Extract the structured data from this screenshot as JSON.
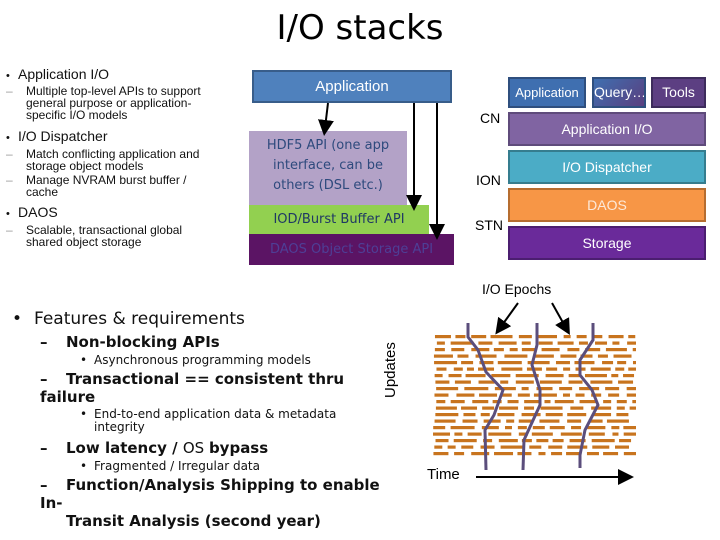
{
  "title": "I/O stacks",
  "top_bullets": [
    {
      "label": "Application I/O",
      "subs": [
        "Multiple top-level APIs to support",
        "general purpose or application-",
        "specific I/O models"
      ]
    },
    {
      "label": "I/O Dispatcher",
      "subs": [
        "Match conflicting application and",
        "storage object models",
        "Manage NVRAM burst buffer /",
        "cache"
      ]
    },
    {
      "label": "DAOS",
      "subs": [
        "Scalable, transactional global",
        "shared object storage"
      ]
    }
  ],
  "middle_stack": {
    "application": "Application",
    "hdf5_lines": [
      "HDF5 API (one app",
      "interface, can be",
      "others (DSL etc.)"
    ],
    "iod": "IOD/Burst Buffer API",
    "daos": "DAOS Object Storage API"
  },
  "right_stack": {
    "row1": [
      "Application",
      "Query…",
      "Tools"
    ],
    "application_io": "Application I/O",
    "dispatcher": "I/O Dispatcher",
    "daos": "DAOS",
    "storage": "Storage",
    "node_labels": [
      "CN",
      "ION",
      "STN"
    ],
    "colors": {
      "application": "#3f6fb0",
      "tools": "#5c3f82",
      "application_io": "#8064a2",
      "dispatcher": "#4bacc6",
      "daos": "#f79646",
      "storage": "#6a2a9a"
    }
  },
  "features": {
    "heading": "Features & requirements",
    "items": [
      {
        "label": "Non-blocking APIs",
        "sub": [
          "Asynchronous programming models"
        ]
      },
      {
        "label": "Transactional == consistent thru failure",
        "sub": [
          "End-to-end application data & metadata",
          "integrity"
        ]
      },
      {
        "label_bold": "Low latency / ",
        "label_normal": "OS ",
        "label_bold2": "bypass",
        "sub": [
          "Fragmented / Irregular data"
        ]
      },
      {
        "label": "Function/Analysis Shipping to enable In-",
        "label2": "Transit Analysis  (second year)",
        "sub": []
      }
    ]
  },
  "epochs_diagram": {
    "title": "I/O Epochs",
    "y_label": "Updates",
    "x_label": "Time",
    "dash_color": "#c8741e",
    "line_color": "#5b4e7c"
  }
}
